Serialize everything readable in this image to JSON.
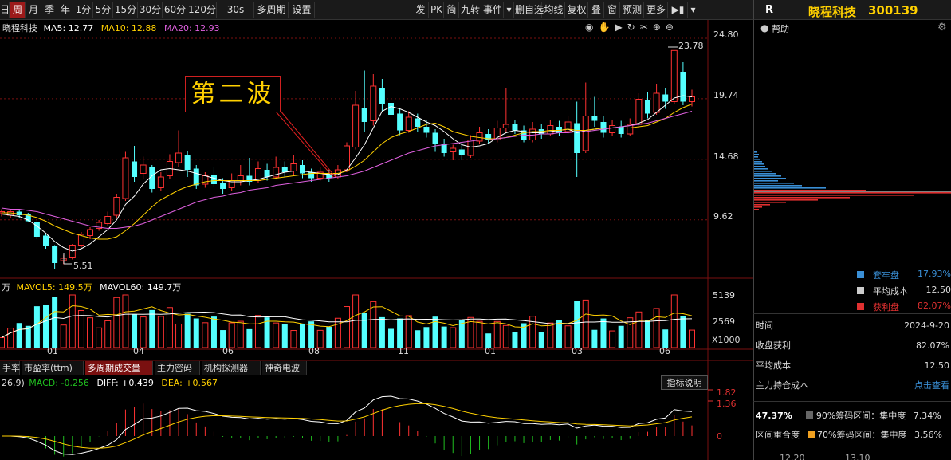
{
  "toolbar": {
    "left_items": [
      "日",
      "周",
      "月",
      "季",
      "年",
      "1分",
      "5分",
      "15分",
      "30分",
      "60分",
      "120分",
      "30s",
      "多周期",
      "设置"
    ],
    "active": "周",
    "right_items": [
      "发",
      "PK",
      "简",
      "九转",
      "事件",
      "▾",
      "删自选",
      "均线",
      "复权",
      "叠",
      "窗",
      "预测",
      "更多",
      "▶▮",
      "▾"
    ]
  },
  "stock": {
    "name": "晓程科技",
    "code": "300139",
    "badge": "R"
  },
  "ma_legend": {
    "title": "晓程科技",
    "ma5": "MA5: 12.77",
    "ma10": "MA10: 12.88",
    "ma20": "MA20: 12.93"
  },
  "annotation": {
    "label": "第二波"
  },
  "price_axis": [
    "24.80",
    "19.74",
    "14.68",
    "9.62"
  ],
  "price_marks": {
    "high": "23.78",
    "low": "5.51"
  },
  "volume": {
    "legend_unit": "万",
    "mavol5": "MAVOL5: 149.5万",
    "mavol60": "MAVOL60: 149.7万",
    "axis": [
      "5139",
      "2569"
    ],
    "unit": "X1000"
  },
  "x_axis": [
    "01",
    "04",
    "06",
    "08",
    "11",
    "01",
    "03",
    "06"
  ],
  "tabs": [
    "手率",
    "市盈率(ttm)",
    "多周期成交量",
    "主力密码",
    "机构探测器",
    "神奇电波"
  ],
  "active_tab": "多周期成交量",
  "macd": {
    "params": "26,9)",
    "macd": "MACD: -0.256",
    "diff": "DIFF: +0.439",
    "dea": "DEA: +0.567",
    "axis": [
      "1.82",
      "1.36",
      "0"
    ],
    "explain_button": "指标说明"
  },
  "right_panel": {
    "help": "帮助",
    "legend": [
      {
        "color": "#3a8fd6",
        "label": "套牢盘",
        "value": "17.93%"
      },
      {
        "color": "#cccccc",
        "label": "平均成本",
        "value": "12.50"
      },
      {
        "color": "#e03030",
        "label": "获利盘",
        "value": "82.07%"
      }
    ],
    "rows": [
      {
        "label": "时间",
        "value": "2024-9-20"
      },
      {
        "label": "收盘获利",
        "value": "82.07%"
      },
      {
        "label": "平均成本",
        "value": "12.50"
      },
      {
        "label": "主力持仓成本",
        "value": "点击查看"
      }
    ],
    "concentration": {
      "pct": "47.37%",
      "r90": "90%筹码区间：集中度",
      "r90v": "7.34%",
      "overlap": "区间重合度",
      "r70": "70%筹码区间：集中度",
      "r70v": "3.56%"
    },
    "bottom_axis": [
      "12.20",
      "13.10"
    ]
  },
  "chart_data": {
    "type": "line",
    "title": "",
    "note": "weekly candlestick chart with MA lines, volume and MACD",
    "price_range": [
      5,
      25
    ],
    "candles": [
      [
        10.2,
        10.3,
        9.9,
        10.5
      ],
      [
        10.0,
        10.3,
        9.8,
        10.4
      ],
      [
        10.3,
        10.0,
        9.8,
        10.4
      ],
      [
        10.1,
        9.5,
        9.4,
        10.2
      ],
      [
        9.4,
        8.2,
        8.0,
        9.5
      ],
      [
        8.3,
        7.4,
        7.2,
        8.5
      ],
      [
        7.4,
        6.0,
        5.51,
        7.5
      ],
      [
        6.2,
        6.4,
        5.9,
        6.7
      ],
      [
        6.5,
        7.5,
        6.3,
        7.6
      ],
      [
        7.5,
        8.4,
        7.3,
        8.6
      ],
      [
        8.3,
        8.8,
        8.0,
        9.0
      ],
      [
        8.9,
        9.4,
        8.7,
        9.6
      ],
      [
        9.3,
        9.9,
        9.1,
        10.3
      ],
      [
        10.0,
        11.5,
        9.8,
        11.8
      ],
      [
        11.4,
        14.8,
        11.2,
        15.3
      ],
      [
        14.5,
        13.2,
        12.8,
        15.8
      ],
      [
        13.5,
        14.2,
        13.0,
        14.9
      ],
      [
        14.0,
        12.2,
        11.9,
        14.2
      ],
      [
        12.3,
        13.2,
        12.0,
        13.6
      ],
      [
        13.3,
        14.5,
        13.0,
        15.1
      ],
      [
        14.4,
        15.2,
        14.0,
        17.1
      ],
      [
        15.0,
        13.8,
        13.2,
        15.4
      ],
      [
        13.9,
        12.5,
        12.2,
        14.2
      ],
      [
        12.6,
        13.3,
        12.3,
        13.6
      ],
      [
        13.4,
        12.6,
        12.4,
        14.0
      ],
      [
        12.7,
        12.2,
        11.8,
        13.1
      ],
      [
        12.3,
        12.9,
        12.0,
        13.5
      ],
      [
        12.9,
        13.3,
        12.5,
        14.2
      ],
      [
        13.3,
        12.8,
        12.5,
        14.8
      ],
      [
        12.9,
        13.9,
        12.7,
        14.5
      ],
      [
        13.8,
        13.2,
        12.9,
        14.3
      ],
      [
        13.2,
        14.0,
        13.0,
        14.9
      ],
      [
        14.0,
        13.6,
        13.2,
        14.5
      ],
      [
        13.7,
        14.3,
        13.3,
        15.0
      ],
      [
        14.2,
        13.5,
        13.1,
        14.6
      ],
      [
        13.6,
        13.1,
        12.8,
        13.9
      ],
      [
        13.1,
        13.6,
        12.9,
        14.0
      ],
      [
        13.5,
        13.1,
        12.8,
        13.8
      ],
      [
        13.2,
        13.8,
        13.0,
        14.2
      ],
      [
        13.8,
        15.8,
        13.6,
        16.1
      ],
      [
        15.7,
        19.2,
        15.5,
        20.4
      ],
      [
        19.0,
        17.8,
        17.0,
        22.1
      ],
      [
        17.9,
        20.8,
        17.5,
        21.8
      ],
      [
        20.6,
        19.3,
        18.6,
        21.4
      ],
      [
        19.4,
        18.4,
        18.0,
        19.9
      ],
      [
        18.5,
        17.1,
        16.7,
        18.9
      ],
      [
        17.1,
        18.2,
        16.9,
        18.7
      ],
      [
        18.1,
        17.4,
        17.0,
        18.5
      ],
      [
        17.4,
        16.9,
        16.5,
        18.0
      ],
      [
        16.9,
        16.0,
        15.3,
        17.2
      ],
      [
        16.0,
        15.2,
        14.9,
        16.4
      ],
      [
        15.3,
        15.6,
        14.6,
        15.9
      ],
      [
        15.5,
        15.0,
        14.6,
        16.1
      ],
      [
        15.0,
        16.3,
        14.8,
        16.7
      ],
      [
        16.2,
        16.9,
        16.0,
        17.4
      ],
      [
        16.8,
        16.3,
        16.0,
        17.2
      ],
      [
        16.3,
        17.3,
        16.1,
        17.9
      ],
      [
        17.3,
        17.6,
        16.9,
        20.6
      ],
      [
        17.6,
        17.1,
        16.8,
        18.0
      ],
      [
        17.1,
        16.3,
        16.1,
        17.5
      ],
      [
        16.3,
        17.2,
        16.1,
        17.8
      ],
      [
        17.2,
        16.8,
        16.4,
        17.6
      ],
      [
        16.8,
        17.5,
        16.6,
        18.0
      ],
      [
        17.4,
        16.9,
        16.6,
        17.9
      ],
      [
        17.0,
        17.8,
        16.8,
        18.3
      ],
      [
        17.7,
        15.2,
        13.2,
        19.5
      ],
      [
        15.4,
        18.3,
        15.2,
        21.1
      ],
      [
        18.3,
        17.9,
        17.4,
        19.9
      ],
      [
        17.8,
        16.9,
        16.5,
        18.3
      ],
      [
        16.9,
        17.5,
        16.6,
        18.0
      ],
      [
        17.4,
        16.8,
        16.5,
        17.9
      ],
      [
        16.8,
        17.6,
        16.6,
        18.1
      ],
      [
        17.6,
        19.7,
        17.4,
        20.2
      ],
      [
        19.6,
        18.5,
        18.1,
        20.3
      ],
      [
        18.6,
        20.2,
        18.4,
        21.0
      ],
      [
        20.1,
        19.5,
        18.9,
        20.6
      ],
      [
        19.5,
        23.78,
        19.3,
        23.78
      ],
      [
        22.0,
        19.5,
        19.2,
        22.8
      ],
      [
        19.5,
        19.9,
        19.1,
        20.5
      ]
    ],
    "ma5": [
      10.1,
      10.0,
      9.9,
      9.6,
      9.1,
      8.5,
      7.8,
      7.3,
      7.0,
      7.2,
      7.6,
      8.2,
      8.8,
      9.6,
      10.9,
      11.6,
      12.6,
      13.3,
      13.8,
      13.9,
      13.8,
      13.7,
      13.5,
      13.3,
      13.1,
      12.9,
      12.8,
      12.8,
      12.9,
      13.0,
      13.2,
      13.4,
      13.6,
      13.7,
      13.7,
      13.6,
      13.5,
      13.4,
      13.4,
      13.8,
      14.8,
      15.9,
      17.3,
      18.7,
      19.1,
      18.9,
      18.6,
      18.2,
      17.8,
      17.5,
      17.0,
      16.4,
      15.9,
      15.7,
      15.8,
      16.0,
      16.5,
      16.9,
      17.1,
      17.0,
      16.9,
      16.9,
      17.0,
      17.1,
      17.2,
      16.9,
      17.1,
      17.2,
      17.3,
      17.3,
      17.4,
      17.5,
      17.7,
      18.0,
      18.6,
      19.2,
      19.8,
      20.0,
      19.9
    ],
    "ma10": [
      10.2,
      10.2,
      10.1,
      10.0,
      9.8,
      9.5,
      9.1,
      8.8,
      8.5,
      8.3,
      8.1,
      8.0,
      8.0,
      8.2,
      8.7,
      9.3,
      10.0,
      10.7,
      11.3,
      11.7,
      12.1,
      12.4,
      12.6,
      12.8,
      12.9,
      12.9,
      12.9,
      12.9,
      12.9,
      12.9,
      13.0,
      13.1,
      13.2,
      13.3,
      13.4,
      13.5,
      13.5,
      13.5,
      13.5,
      13.7,
      14.1,
      14.6,
      15.3,
      16.0,
      16.5,
      16.8,
      17.0,
      17.3,
      17.6,
      17.7,
      17.4,
      17.0,
      16.8,
      16.6,
      16.5,
      16.4,
      16.4,
      16.5,
      16.7,
      16.9,
      17.0,
      17.0,
      17.1,
      17.1,
      17.2,
      17.1,
      17.1,
      17.2,
      17.3,
      17.3,
      17.3,
      17.3,
      17.4,
      17.5,
      17.8,
      18.1,
      18.6,
      19.0,
      19.3
    ],
    "ma20": [
      10.6,
      10.5,
      10.5,
      10.4,
      10.3,
      10.1,
      9.9,
      9.7,
      9.5,
      9.3,
      9.1,
      9.0,
      8.9,
      8.9,
      9.0,
      9.1,
      9.3,
      9.6,
      9.9,
      10.2,
      10.5,
      10.8,
      11.1,
      11.3,
      11.5,
      11.6,
      11.8,
      11.9,
      12.1,
      12.2,
      12.3,
      12.5,
      12.6,
      12.7,
      12.8,
      12.9,
      13.0,
      13.1,
      13.2,
      13.3,
      13.5,
      13.7,
      14.0,
      14.3,
      14.6,
      14.9,
      15.2,
      15.4,
      15.6,
      15.8,
      15.9,
      16.0,
      16.1,
      16.2,
      16.3,
      16.3,
      16.4,
      16.5,
      16.6,
      16.7,
      16.7,
      16.8,
      16.8,
      16.9,
      16.9,
      17.0,
      17.0,
      17.1,
      17.2,
      17.3,
      17.4,
      17.5,
      17.6,
      17.7,
      17.9,
      18.1,
      18.3,
      18.5,
      18.7
    ]
  }
}
